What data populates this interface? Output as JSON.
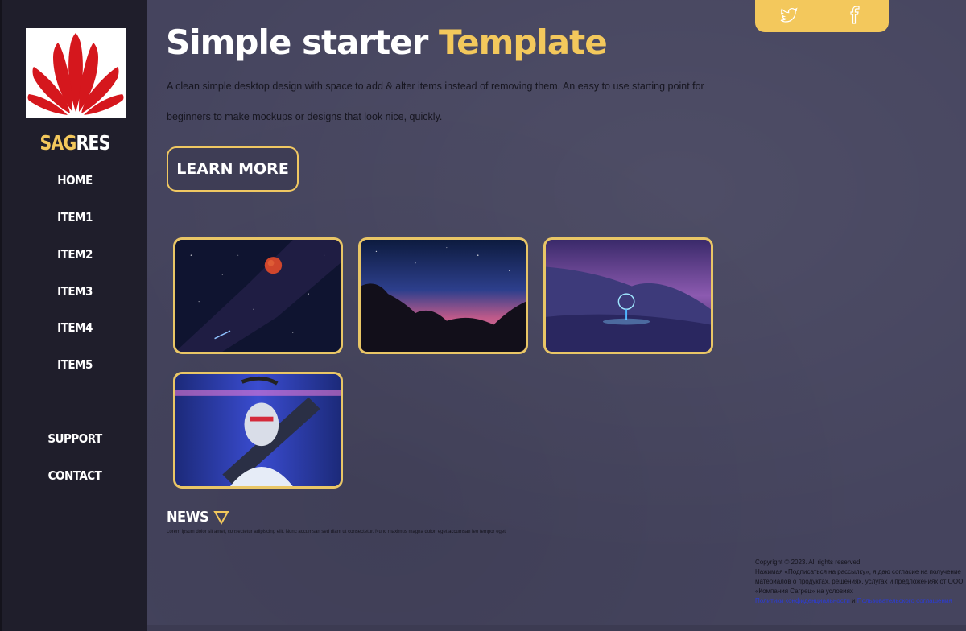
{
  "sidebar": {
    "logo_icon": "huawei-flower-logo",
    "brand_accent": "SAG",
    "brand_rest": "RES",
    "nav": [
      {
        "label": "HOME"
      },
      {
        "label": "ITEM1"
      },
      {
        "label": "ITEM2"
      },
      {
        "label": "ITEM3"
      },
      {
        "label": "ITEM4"
      },
      {
        "label": "ITEM5"
      }
    ],
    "bottom_nav": [
      {
        "label": "SUPPORT"
      },
      {
        "label": "CONTACT"
      }
    ]
  },
  "hero": {
    "title_part1": "Simple starter",
    "title_part2": "Template",
    "description": "A clean simple desktop design with space to add & alter items instead of removing them. An easy to use starting point for beginners to make mockups or designs that look nice, quickly.",
    "button_label": "LEARN MORE"
  },
  "social": {
    "icons": [
      "twitter-icon",
      "facebook-icon"
    ]
  },
  "gallery": {
    "images": [
      "night-sky-moon",
      "starry-rocks",
      "light-orb-snow",
      "cyber-figure"
    ]
  },
  "news": {
    "title": "NEWS",
    "text": "Lorem ipsum dolor sit amet, consectetur adipiscing elit. Nunc accumsan sed diam ut consectetur. Nunc maximus magna dolor, eget accumsan leo tempor eget."
  },
  "footer": {
    "copyright": "Copyright © 2023. All rights reserved",
    "consent_text": "Нажимая «Подписаться на рассылку», я даю согласие на получение материалов о продуктах, решениях, услугах и предложениях от ООО «Компания Сагрец» на условиях",
    "privacy_link": "Политики конфиденциальности",
    "conjunction": "и",
    "agreement_link": "Пользовательского соглашения"
  },
  "colors": {
    "accent": "#f3c85c",
    "background": "#46455f",
    "sidebar": "#1f1e2b"
  }
}
